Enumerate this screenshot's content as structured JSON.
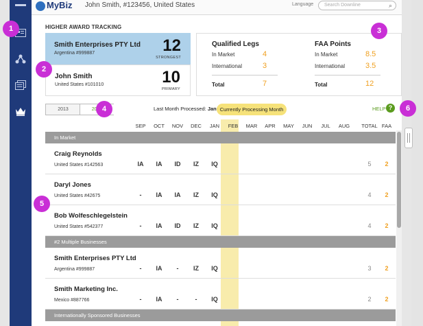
{
  "topbar": {
    "logo": "MyBiz",
    "user": "John Smith, #123456, United States",
    "language_label": "Language",
    "search_placeholder": "Search Downline"
  },
  "tracking": {
    "title": "HIGHER AWARD TRACKING",
    "strongest": {
      "name": "Smith Enterprises PTY Ltd",
      "sub": "Argentina #999887",
      "number": "12",
      "caption": "STRONGEST"
    },
    "primary": {
      "name": "John Smith",
      "sub": "United States #101010",
      "number": "10",
      "caption": "PRIMARY"
    }
  },
  "legs": {
    "title": "Qualified Legs",
    "in_market_label": "In Market",
    "in_market": "4",
    "international_label": "International",
    "international": "3",
    "total_label": "Total",
    "total": "7"
  },
  "faa": {
    "title": "FAA Points",
    "in_market_label": "In Market",
    "in_market": "8.5",
    "international_label": "International",
    "international": "3.5",
    "total_label": "Total",
    "total": "12"
  },
  "controls": {
    "year_2013": "2013",
    "year_2014": "2014",
    "last_month_label": "Last Month Processed:",
    "last_month_value": "January",
    "processing_pill": "Currently Processing Month",
    "help": "HELP",
    "help_glyph": "?"
  },
  "grid": {
    "months": [
      "SEP",
      "OCT",
      "NOV",
      "DEC",
      "JAN",
      "FEB",
      "MAR",
      "APR",
      "MAY",
      "JUN",
      "JUL",
      "AUG"
    ],
    "total_header": "TOTAL",
    "faa_header": "FAA",
    "sections": [
      {
        "label": "In Market",
        "rows": [
          {
            "name": "Craig Reynolds",
            "sub": "United States #142563",
            "cells": [
              "IA",
              "IA",
              "ID",
              "IZ",
              "IQ"
            ],
            "total": "5",
            "faa": "2"
          },
          {
            "name": "Daryl Jones",
            "sub": "United States #42675",
            "cells": [
              "-",
              "IA",
              "IA",
              "IZ",
              "IQ"
            ],
            "total": "4",
            "faa": "2"
          },
          {
            "name": "Bob Wolfeschlegelstein",
            "sub": "United States #542377",
            "cells": [
              "-",
              "IA",
              "ID",
              "IZ",
              "IQ"
            ],
            "total": "4",
            "faa": "2"
          }
        ]
      },
      {
        "label": "#2 Multiple Businesses",
        "rows": [
          {
            "name": "Smith Enterprises PTY Ltd",
            "sub": "Argentina #999887",
            "cells": [
              "-",
              "IA",
              "-",
              "IZ",
              "IQ"
            ],
            "total": "3",
            "faa": "2"
          },
          {
            "name": "Smith Marketing Inc.",
            "sub": "Mexico #887766",
            "cells": [
              "-",
              "IA",
              "-",
              "-",
              "IQ"
            ],
            "total": "2",
            "faa": "2"
          }
        ]
      },
      {
        "label": "Internationally Sponsored Businesses",
        "rows": []
      }
    ]
  },
  "markers": [
    "1",
    "2",
    "3",
    "4",
    "5",
    "6"
  ],
  "colors": {
    "sidebar": "#1f3a7a",
    "accent_orange": "#f0a020",
    "accent_green": "#5a9b1e",
    "highlight_blue": "#aed1ea",
    "marker": "#c92fd6",
    "current_month": "#f8ecac"
  }
}
